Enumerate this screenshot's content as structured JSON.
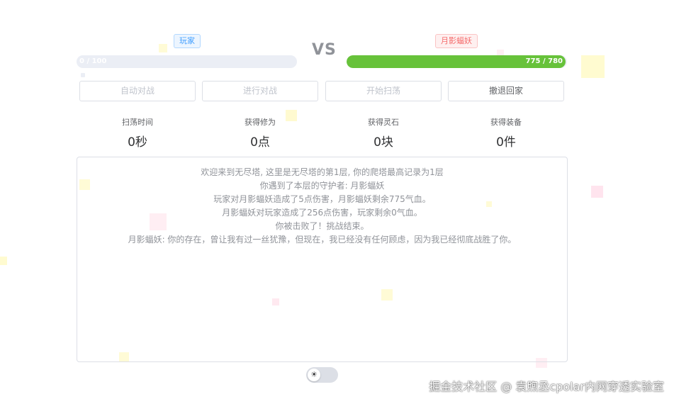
{
  "player": {
    "tag": "玩家",
    "hp_text": "0 / 100",
    "hp_fraction": 0.0
  },
  "vs": "VS",
  "enemy": {
    "tag": "月影蝠妖",
    "hp_text": "775 / 780",
    "hp_fraction": 0.9936
  },
  "buttons": {
    "auto_battle": "自动对战",
    "battle": "进行对战",
    "sweep": "开始扫荡",
    "retreat": "撤退回家"
  },
  "stats": [
    {
      "label": "扫荡时间",
      "value": "0秒"
    },
    {
      "label": "获得修为",
      "value": "0点"
    },
    {
      "label": "获得灵石",
      "value": "0块"
    },
    {
      "label": "获得装备",
      "value": "0件"
    }
  ],
  "log": [
    "欢迎来到无尽塔, 这里是无尽塔的第1层, 你的爬塔最高记录为1层",
    "你遇到了本层的守护者: 月影蝠妖",
    "玩家对月影蝠妖造成了5点伤害，月影蝠妖剩余775气血。",
    "月影蝠妖对玩家造成了256点伤害，玩家剩余0气血。",
    "你被击败了！挑战结束。",
    "月影蝠妖: 你的存在，曾让我有过一丝犹豫，但现在，我已经没有任何顾虑，因为我已经彻底战胜了你。"
  ],
  "theme_toggle_icon": "sun-icon",
  "watermark": "掘金技术社区 @ 袁煦丞cpolar内网穿透实验室",
  "colors": {
    "hp_fill": "#67c23a",
    "player_tag": "#409eff",
    "enemy_tag": "#f56c6c"
  }
}
